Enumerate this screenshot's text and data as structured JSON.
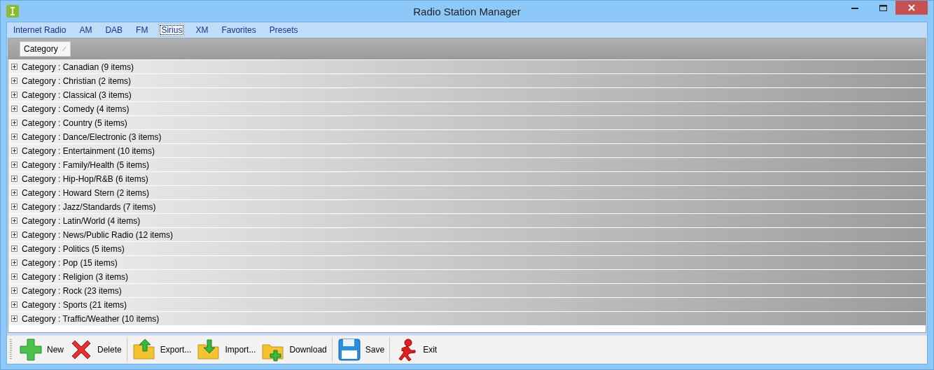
{
  "window": {
    "title": "Radio Station Manager"
  },
  "tabs": [
    {
      "label": "Internet Radio",
      "selected": false
    },
    {
      "label": "AM",
      "selected": false
    },
    {
      "label": "DAB",
      "selected": false
    },
    {
      "label": "FM",
      "selected": false
    },
    {
      "label": "Sirius",
      "selected": true
    },
    {
      "label": "XM",
      "selected": false
    },
    {
      "label": "Favorites",
      "selected": false
    },
    {
      "label": "Presets",
      "selected": false
    }
  ],
  "grid": {
    "group_header": "Category",
    "groups": [
      {
        "label": "Category : Canadian (9 items)",
        "expanded": false
      },
      {
        "label": "Category : Christian (2 items)",
        "expanded": false
      },
      {
        "label": "Category : Classical (3 items)",
        "expanded": false
      },
      {
        "label": "Category : Comedy (4 items)",
        "expanded": false
      },
      {
        "label": "Category : Country (5 items)",
        "expanded": false
      },
      {
        "label": "Category : Dance/Electronic (3 items)",
        "expanded": false
      },
      {
        "label": "Category : Entertainment (10 items)",
        "expanded": false
      },
      {
        "label": "Category : Family/Health (5 items)",
        "expanded": false
      },
      {
        "label": "Category : Hip-Hop/R&B (6 items)",
        "expanded": false
      },
      {
        "label": "Category : Howard Stern (2 items)",
        "expanded": false
      },
      {
        "label": "Category : Jazz/Standards (7 items)",
        "expanded": false
      },
      {
        "label": "Category : Latin/World (4 items)",
        "expanded": false
      },
      {
        "label": "Category : News/Public Radio (12 items)",
        "expanded": false
      },
      {
        "label": "Category : Politics (5 items)",
        "expanded": false
      },
      {
        "label": "Category : Pop (15 items)",
        "expanded": false
      },
      {
        "label": "Category : Religion (3 items)",
        "expanded": false
      },
      {
        "label": "Category : Rock (23 items)",
        "expanded": false
      },
      {
        "label": "Category : Sports (21 items)",
        "expanded": false
      },
      {
        "label": "Category : Traffic/Weather (10 items)",
        "expanded": false
      }
    ]
  },
  "toolbar": [
    {
      "label": "New",
      "kind": "new",
      "separator_after": false
    },
    {
      "label": "Delete",
      "kind": "delete",
      "separator_after": true
    },
    {
      "label": "Export...",
      "kind": "export",
      "separator_after": false
    },
    {
      "label": "Import...",
      "kind": "import",
      "separator_after": false
    },
    {
      "label": "Download",
      "kind": "download",
      "separator_after": true
    },
    {
      "label": "Save",
      "kind": "save",
      "separator_after": true
    },
    {
      "label": "Exit",
      "kind": "exit",
      "separator_after": false
    }
  ]
}
